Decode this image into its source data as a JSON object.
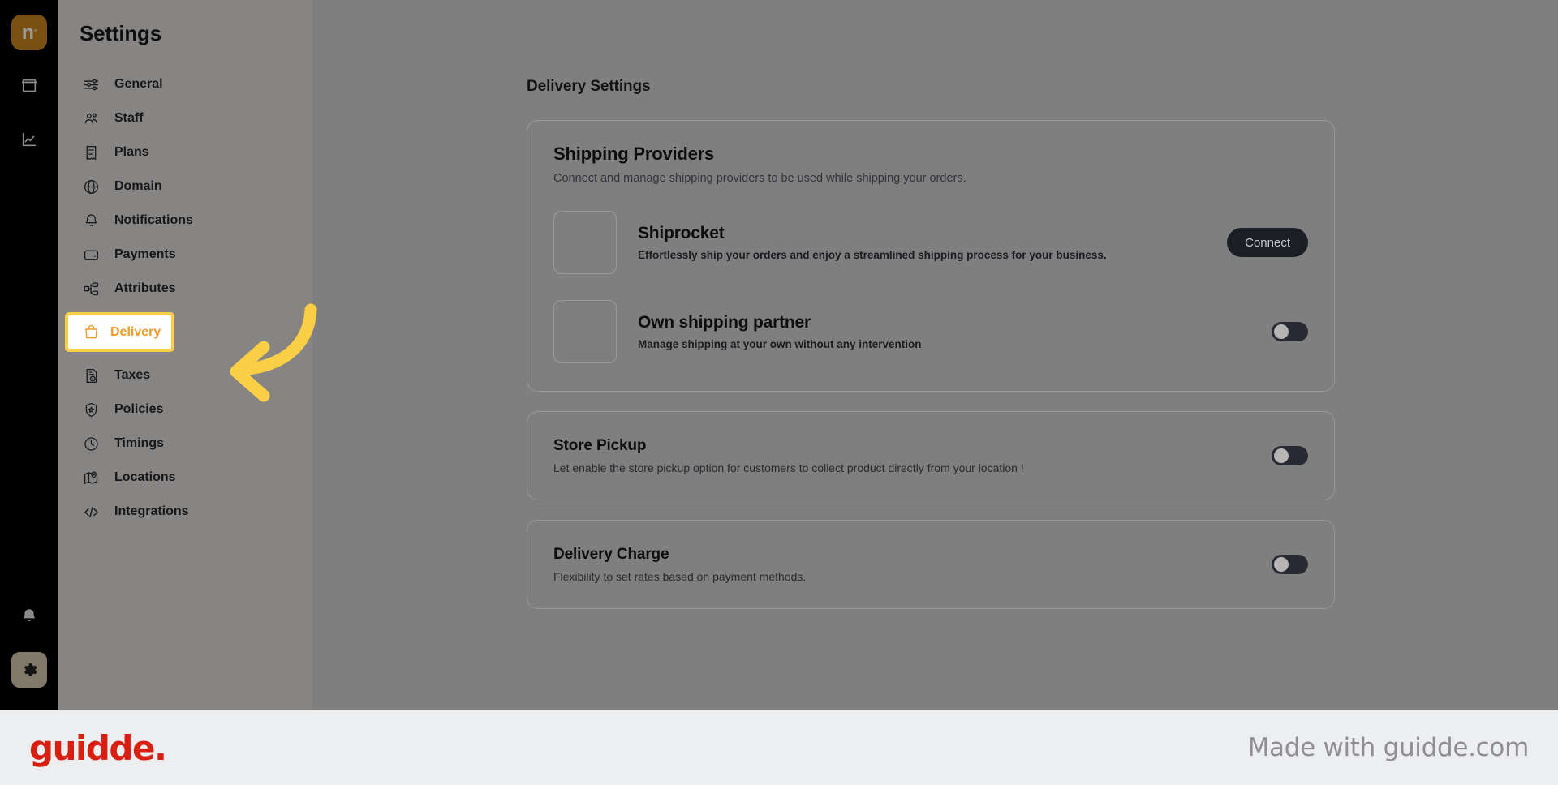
{
  "brand": {
    "logo_mark": "n",
    "logo_sup": "°",
    "logo_bg": "#7a4f12"
  },
  "icon_rail": {
    "items": [
      {
        "name": "store-icon",
        "label": "Store"
      },
      {
        "name": "analytics-icon",
        "label": "Analytics"
      }
    ],
    "bottom_items": [
      {
        "name": "bell-icon",
        "label": "Notifications"
      },
      {
        "name": "gear-icon",
        "label": "Settings",
        "active": true
      }
    ]
  },
  "sidebar": {
    "title": "Settings",
    "items": [
      {
        "label": "General",
        "icon": "sliders-icon"
      },
      {
        "label": "Staff",
        "icon": "users-icon"
      },
      {
        "label": "Plans",
        "icon": "receipt-icon"
      },
      {
        "label": "Domain",
        "icon": "globe-icon"
      },
      {
        "label": "Notifications",
        "icon": "bell-icon"
      },
      {
        "label": "Payments",
        "icon": "wallet-icon"
      },
      {
        "label": "Attributes",
        "icon": "hierarchy-icon"
      },
      {
        "label": "Delivery",
        "icon": "shopping-bag-icon",
        "current": true
      },
      {
        "label": "Taxes",
        "icon": "tax-document-icon"
      },
      {
        "label": "Policies",
        "icon": "shield-star-icon"
      },
      {
        "label": "Timings",
        "icon": "clock-icon"
      },
      {
        "label": "Locations",
        "icon": "map-pin-icon"
      },
      {
        "label": "Integrations",
        "icon": "code-brackets-icon"
      }
    ],
    "highlight_border_color": "#facf46",
    "highlight_text_color": "#f09a2b"
  },
  "main": {
    "page_heading": "Delivery Settings",
    "providers_card": {
      "title": "Shipping Providers",
      "subtitle": "Connect and manage shipping providers to be used while shipping your orders.",
      "rows": [
        {
          "name": "Shiprocket",
          "description": "Effortlessly ship your orders and enjoy a streamlined shipping process for your business.",
          "action_type": "button",
          "action_label": "Connect"
        },
        {
          "name": "Own shipping partner",
          "description": "Manage shipping at your own without any intervention",
          "action_type": "toggle",
          "toggle_state": "off"
        }
      ]
    },
    "sections": [
      {
        "title": "Store Pickup",
        "subtitle": "Let enable the store pickup option for customers to collect product directly from your location !",
        "toggle_state": "off"
      },
      {
        "title": "Delivery Charge",
        "subtitle": "Flexibility to set rates based on payment methods.",
        "toggle_state": "off"
      }
    ]
  },
  "annotation": {
    "type": "curved-arrow-left",
    "color": "#facf46",
    "points_to": "Delivery"
  },
  "footer": {
    "logo_text": "guidde.",
    "tagline": "Made with guidde.com",
    "logo_color": "#d91f12",
    "tagline_color": "#8f8f93"
  }
}
